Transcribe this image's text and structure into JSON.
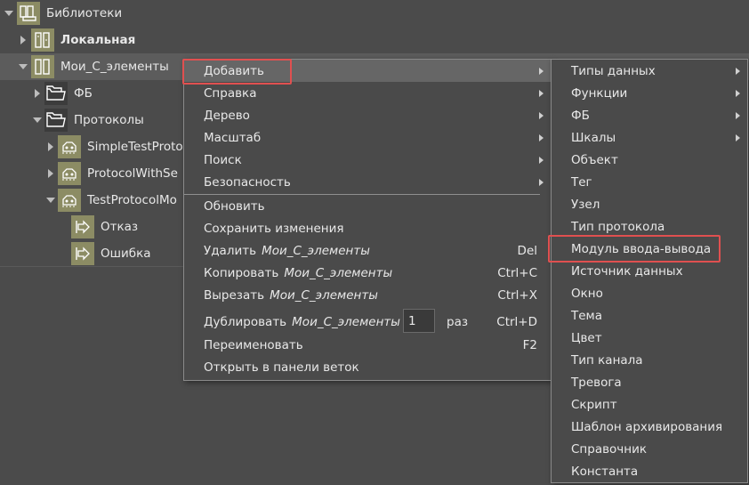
{
  "tree": {
    "root": {
      "label": "Библиотеки",
      "icon": "library-icon"
    },
    "local": {
      "label": "Локальная",
      "icon": "library-book-icon"
    },
    "my_elements": {
      "label": "Мои_С_элементы",
      "icon": "library-book-icon"
    },
    "fb": {
      "label": "ФБ",
      "icon": "folder-icon"
    },
    "protocols": {
      "label": "Протоколы",
      "icon": "folder-icon"
    },
    "protocol1": {
      "label": "SimpleTestProto",
      "icon": "protocol-icon"
    },
    "protocol2": {
      "label": "ProtocolWithSe",
      "icon": "protocol-icon"
    },
    "protocol3": {
      "label": "TestProtocolMo",
      "icon": "protocol-icon"
    },
    "refusal": {
      "label": "Отказ",
      "icon": "transition-icon"
    },
    "error": {
      "label": "Ошибка",
      "icon": "transition-icon"
    }
  },
  "context_menu": {
    "add": "Добавить",
    "help": "Справка",
    "tree": "Дерево",
    "scale": "Масштаб",
    "search": "Поиск",
    "security": "Безопасность",
    "refresh": "Обновить",
    "save": "Сохранить изменения",
    "delete": "Удалить",
    "delete_shortcut": "Del",
    "copy": "Копировать",
    "copy_shortcut": "Ctrl+C",
    "cut": "Вырезать",
    "cut_shortcut": "Ctrl+X",
    "duplicate": "Дублировать",
    "duplicate_count": "1",
    "duplicate_times": "раз",
    "duplicate_shortcut": "Ctrl+D",
    "rename": "Переименовать",
    "rename_shortcut": "F2",
    "open_branch": "Открыть в панели веток",
    "target_object": "Мои_С_элементы"
  },
  "submenu": {
    "items": [
      "Типы данных",
      "Функции",
      "ФБ",
      "Шкалы",
      "Объект",
      "Тег",
      "Узел",
      "Тип протокола",
      "Модуль ввода-вывода",
      "Источник данных",
      "Окно",
      "Тема",
      "Цвет",
      "Тип канала",
      "Тревога",
      "Скрипт",
      "Шаблон архивирования",
      "Справочник",
      "Константа"
    ]
  },
  "colors": {
    "background": "#4b4b4b",
    "icon_olive": "#8c8c64",
    "highlight_box": "#e05050",
    "menu_active": "#666666"
  }
}
